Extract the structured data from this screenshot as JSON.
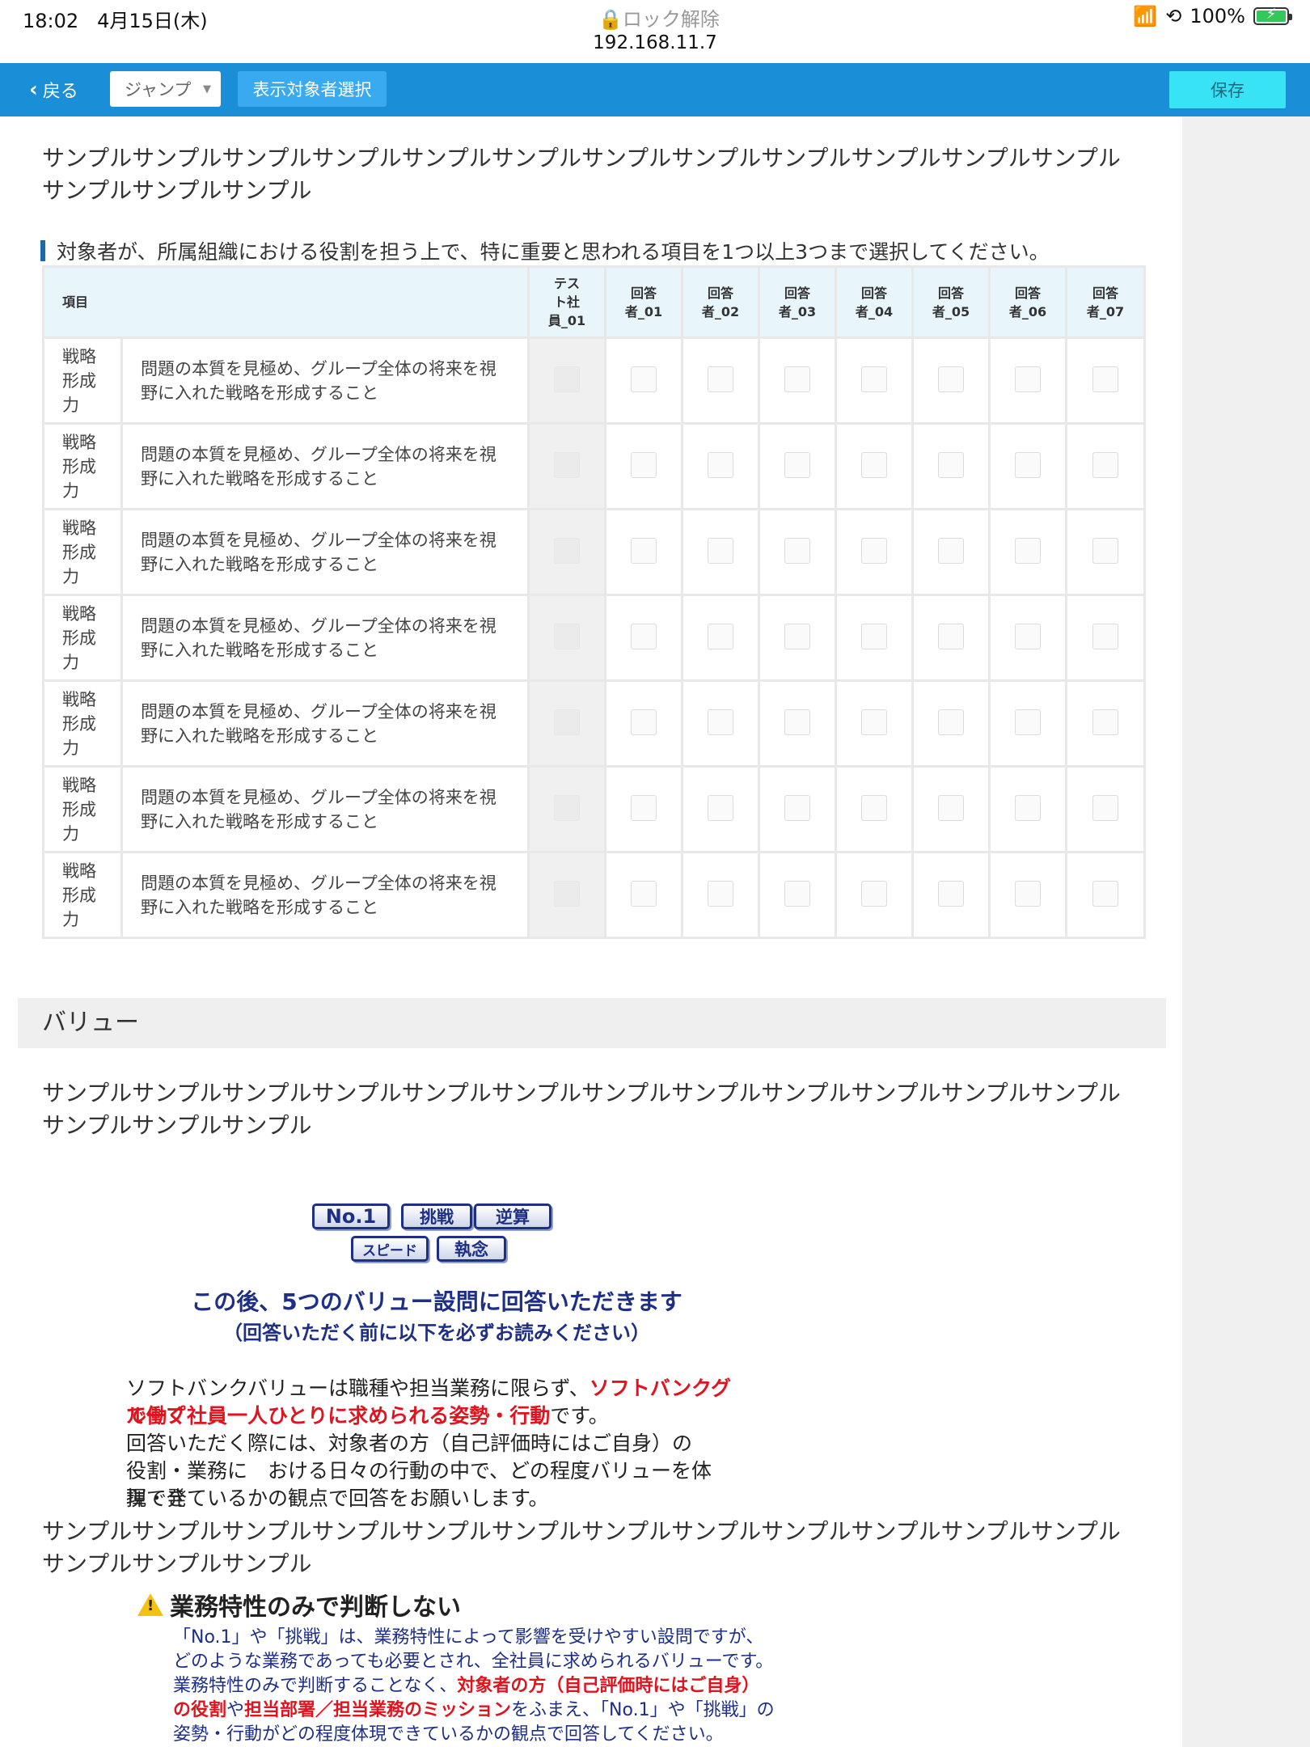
{
  "status_bar": {
    "time": "18:02",
    "date": "4月15日(木)",
    "lock_label": "ロック解除",
    "url": "192.168.11.7",
    "battery": "100%"
  },
  "toolbar": {
    "back_label": "戻る",
    "jump_label": "ジャンプ",
    "target_label": "表示対象者選択",
    "save_label": "保存"
  },
  "intro_text": "サンプルサンプルサンプルサンプルサンプルサンプルサンプルサンプルサンプルサンプルサンプルサンプルサンプルサンプルサンプル",
  "question": "対象者が、所属組織における役割を担う上で、特に重要と思われる項目を1つ以上3つまで選択してください。",
  "table": {
    "header_item": "項目",
    "columns": [
      {
        "line1": "テス",
        "line2": "ト社",
        "line3": "員_01"
      },
      {
        "line1": "回答",
        "line2": "者_01"
      },
      {
        "line1": "回答",
        "line2": "者_02"
      },
      {
        "line1": "回答",
        "line2": "者_03"
      },
      {
        "line1": "回答",
        "line2": "者_04"
      },
      {
        "line1": "回答",
        "line2": "者_05"
      },
      {
        "line1": "回答",
        "line2": "者_06"
      },
      {
        "line1": "回答",
        "line2": "者_07"
      }
    ],
    "rows": [
      {
        "cat1": "戦略",
        "cat2": "形成",
        "cat3": "力",
        "desc1": "問題の本質を見極め、グループ全体の将来を視",
        "desc2": "野に入れた戦略を形成すること"
      },
      {
        "cat1": "戦略",
        "cat2": "形成",
        "cat3": "力",
        "desc1": "問題の本質を見極め、グループ全体の将来を視",
        "desc2": "野に入れた戦略を形成すること"
      },
      {
        "cat1": "戦略",
        "cat2": "形成",
        "cat3": "力",
        "desc1": "問題の本質を見極め、グループ全体の将来を視",
        "desc2": "野に入れた戦略を形成すること"
      },
      {
        "cat1": "戦略",
        "cat2": "形成",
        "cat3": "力",
        "desc1": "問題の本質を見極め、グループ全体の将来を視",
        "desc2": "野に入れた戦略を形成すること"
      },
      {
        "cat1": "戦略",
        "cat2": "形成",
        "cat3": "力",
        "desc1": "問題の本質を見極め、グループ全体の将来を視",
        "desc2": "野に入れた戦略を形成すること"
      },
      {
        "cat1": "戦略",
        "cat2": "形成",
        "cat3": "力",
        "desc1": "問題の本質を見極め、グループ全体の将来を視",
        "desc2": "野に入れた戦略を形成すること"
      },
      {
        "cat1": "戦略",
        "cat2": "形成",
        "cat3": "力",
        "desc1": "問題の本質を見極め、グループ全体の将来を視",
        "desc2": "野に入れた戦略を形成すること"
      }
    ]
  },
  "section_title": "バリュー",
  "section_intro_text": "サンプルサンプルサンプルサンプルサンプルサンプルサンプルサンプルサンプルサンプルサンプルサンプルサンプルサンプルサンプル",
  "graphic": {
    "tags": [
      "No.1",
      "挑戦",
      "逆算",
      "スピード",
      "執念"
    ],
    "headline": "この後、5つのバリュー設問に回答いただきます",
    "subheadline": "（回答いただく前に以下を必ずお読みください）",
    "body_a1": "ソフトバンクバリューは職種や担当業務に限らず、",
    "body_a1_red": "ソフトバンクグループ",
    "body_a2_red": "で働く社員一人ひとりに求められる姿勢・行動",
    "body_a2": "です。",
    "body_b": "回答いただく際には、対象者の方（自己評価時にはご自身）の",
    "body_c": "役割・業務に　おける日々の行動の中で、どの程度バリューを体現・発",
    "body_d": "揮できているかの観点で回答をお願いします。",
    "warn_title": "業務特性のみで判断しない",
    "warn_l1": "「No.1」や「挑戦」は、業務特性によって影響を受けやすい設問ですが、",
    "warn_l2": "どのような業務であっても必要とされ、全社員に求められるバリューです。",
    "warn_l3": "業務特性のみで判断することなく、",
    "warn_l3_red": "対象者の方（自己評価時にはご自身）",
    "warn_l4_red1": "の役割",
    "warn_l4_mid": "や",
    "warn_l4_red2": "担当部署／担当業務のミッション",
    "warn_l4_end": "をふまえ、「No.1」や「挑戦」の",
    "warn_l5": "姿勢・行動がどの程度体現できているかの観点で回答してください。"
  },
  "overlay_text": "サンプルサンプルサンプルサンプルサンプルサンプルサンプルサンプルサンプルサンプルサンプルサンプルサンプルサンプルサンプル"
}
